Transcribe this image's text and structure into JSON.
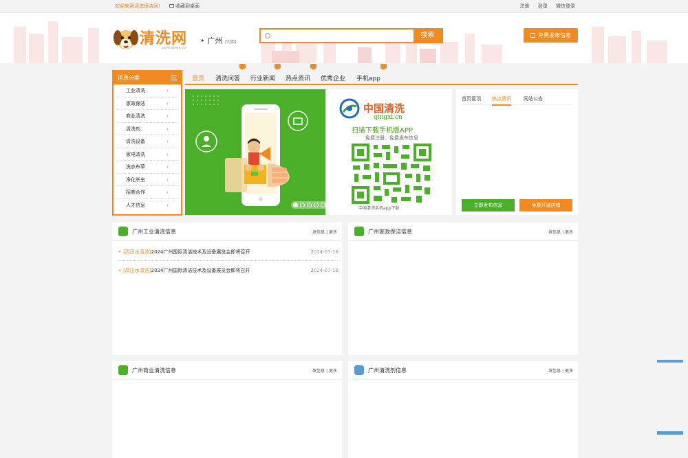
{
  "topbar": {
    "welcome": "欢迎来到清洗保洁网!",
    "favorite": "收藏到桌面",
    "register": "注册",
    "login": "登录",
    "wechat_login": "微信登录"
  },
  "header": {
    "brand": "清洗网",
    "domain": "www.qingxi.cn",
    "city": "广州",
    "city_switch": "[切换]",
    "search_placeholder": "",
    "search_button": "搜索",
    "publish_button": "免费发布信息"
  },
  "categories": {
    "title": "信息分类",
    "items": [
      "工业清洗",
      "家政保洁",
      "商业清洗",
      "清洗剂",
      "清洗设备",
      "家电清洗",
      "洗衣布草",
      "净化杀虫",
      "招商合作",
      "人才信息"
    ]
  },
  "nav": {
    "items": [
      "首页",
      "清洗问答",
      "行业新闻",
      "热点资讯",
      "优秀企业",
      "手机app"
    ]
  },
  "banner": {
    "title": "中国清洗",
    "url": "qingxi.cn",
    "scan_text": "扫描下载手机版APP",
    "free_text": "免费注册、免费发布信息",
    "caption": "中国清洗手机app下载"
  },
  "notice": {
    "tabs": [
      "首页置顶",
      "热点资讯",
      "网站公告"
    ],
    "publish_now": "立即发布信息",
    "open_shop": "免费开通店铺"
  },
  "panels": [
    {
      "title": "广州工业清洗信息",
      "actions": "发信息 | 更多",
      "rows": [
        {
          "tag": "[高压水清洗]",
          "text": "2024广州国际清洁技术及设备展览会即将召开",
          "date": "2024-07-16"
        },
        {
          "tag": "[高压水清洗]",
          "text": "2024广州国际清洁技术及设备展览会即将召开",
          "date": "2024-07-16"
        }
      ]
    },
    {
      "title": "广州家政保洁信息",
      "actions": "发信息 | 更多"
    },
    {
      "title": "广州商业清洗信息",
      "actions": "发信息 | 更多"
    },
    {
      "title": "广州清洗剂信息",
      "actions": "发信息 | 更多"
    }
  ],
  "colors": {
    "accent": "#f28a1f",
    "green": "#4caf2a",
    "blue": "#5b9bd5"
  }
}
